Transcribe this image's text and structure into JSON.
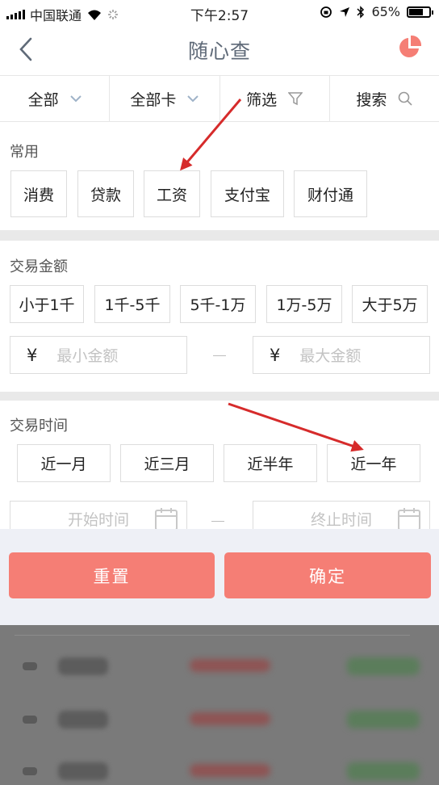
{
  "status_bar": {
    "carrier": "中国联通",
    "time": "下午2:57",
    "battery": "65%",
    "battery_level": 0.65
  },
  "nav": {
    "title": "随心查",
    "back_icon": "chevron-left-icon",
    "chart_icon": "pie-chart-icon",
    "accent": "#f57e75"
  },
  "filter_bar": {
    "all": "全部",
    "all_cards": "全部卡",
    "filter": "筛选",
    "search": "搜索"
  },
  "common": {
    "title": "常用",
    "tags": [
      "消费",
      "贷款",
      "工资",
      "支付宝",
      "财付通"
    ]
  },
  "amount": {
    "title": "交易金额",
    "tags": [
      "小于1千",
      "1千-5千",
      "5千-1万",
      "1万-5万",
      "大于5万"
    ],
    "currency": "¥",
    "min_placeholder": "最小金额",
    "max_placeholder": "最大金额"
  },
  "time": {
    "title": "交易时间",
    "tags": [
      "近一月",
      "近三月",
      "近半年",
      "近一年"
    ],
    "start_placeholder": "开始时间",
    "end_placeholder": "终止时间"
  },
  "actions": {
    "reset": "重置",
    "confirm": "确定"
  }
}
